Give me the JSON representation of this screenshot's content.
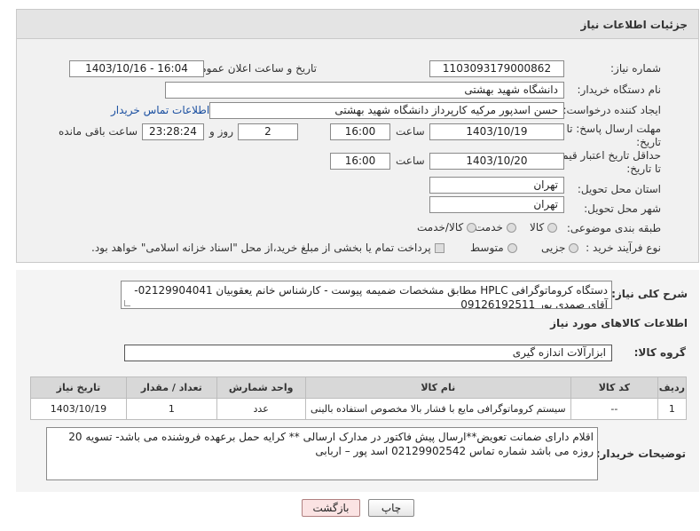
{
  "header": {
    "title": "جزئیات اطلاعات نیاز"
  },
  "fields": {
    "need_number_label": "شماره نیاز:",
    "need_number": "1103093179000862",
    "announce_label": "تاریخ و ساعت اعلان عمومی:",
    "announce_value": "1403/10/16 - 16:04",
    "buyer_label": "نام دستگاه خریدار:",
    "buyer_value": "دانشگاه شهید بهشتی",
    "creator_label": "ایجاد کننده درخواست:",
    "creator_value": "حسن اسدپور مرکیه کارپرداز دانشگاه شهید بهشتی",
    "contact_link": "اطلاعات تماس خریدار",
    "deadline_label": "مهلت ارسال پاسخ: تا تاریخ:",
    "deadline_date": "1403/10/19",
    "time_label": "ساعت",
    "deadline_time": "16:00",
    "days_value": "2",
    "days_label": "روز و",
    "remaining_value": "23:28:24",
    "remaining_label": "ساعت باقی مانده",
    "validity_label": "حداقل تاریخ اعتبار قیمت: تا تاریخ:",
    "validity_date": "1403/10/20",
    "validity_time": "16:00",
    "province_label": "استان محل تحویل:",
    "province_value": "تهران",
    "city_label": "شهر محل تحویل:",
    "city_value": "تهران",
    "category_label": "طبقه بندی موضوعی:",
    "category_options": [
      "کالا",
      "خدمت",
      "کالا/خدمت"
    ],
    "process_label": "نوع فرآیند خرید :",
    "process_options": [
      "جزیی",
      "متوسط"
    ],
    "payment_note": "پرداخت تمام یا بخشی از مبلغ خرید،از محل \"اسناد خزانه اسلامی\" خواهد بود."
  },
  "description": {
    "label": "شرح کلی نیاز:",
    "text": "دستگاه کروماتوگرافی HPLC  مطابق مشخصات ضمیمه پیوست - کارشناس خانم یعقوبیان 02129904041- آقای صمدی پور 09126192511"
  },
  "goods": {
    "section_title": "اطلاعات کالاهای مورد نیاز",
    "group_label": "گروه کالا:",
    "group_value": "ابزارآلات اندازه گیری",
    "columns": [
      "ردیف",
      "کد کالا",
      "نام کالا",
      "واحد شمارش",
      "تعداد / مقدار",
      "تاریخ نیاز"
    ],
    "rows": [
      [
        "1",
        "--",
        "سیستم کروماتوگرافی مایع با فشار بالا مخصوص استفاده بالینی",
        "عدد",
        "1",
        "1403/10/19"
      ]
    ]
  },
  "buyer_notes": {
    "label": "توضیحات خریدار:",
    "text": "اقلام دارای ضمانت تعویض**ارسال پیش فاکتور در مدارک ارسالی **  کرایه حمل برعهده فروشنده می باشد- تسویه 20 روزه می باشد شماره تماس 02129902542 اسد پور – اربابی"
  },
  "buttons": {
    "print": "چاپ",
    "back": "بازگشت"
  },
  "watermark": "AriaTender.neT",
  "colors": {
    "link": "#1a4fa0",
    "back_button_bg": "#fbe3e3"
  }
}
